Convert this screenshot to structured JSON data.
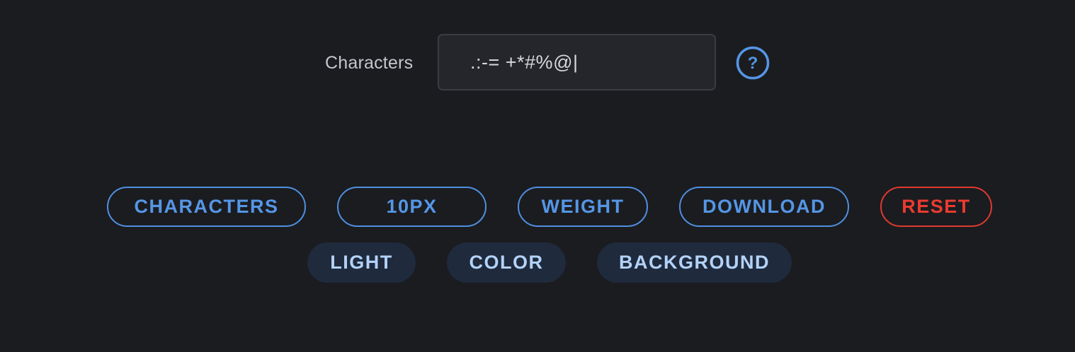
{
  "characters_field": {
    "label": "Characters",
    "value": " .:-= +*#%@|"
  },
  "help": {
    "icon": "question-circle-icon",
    "glyph": "?"
  },
  "toolbar": {
    "characters_label": "CHARACTERS",
    "size_label": "10PX",
    "weight_label": "WEIGHT",
    "download_label": "DOWNLOAD",
    "reset_label": "RESET"
  },
  "options": {
    "light_label": "LIGHT",
    "color_label": "COLOR",
    "background_label": "BACKGROUND"
  },
  "colors": {
    "background": "#1b1c20",
    "accent": "#5596e6",
    "danger": "#ea3b30",
    "chip_background": "#1f2a3d",
    "chip_text": "#b3d2f7"
  }
}
